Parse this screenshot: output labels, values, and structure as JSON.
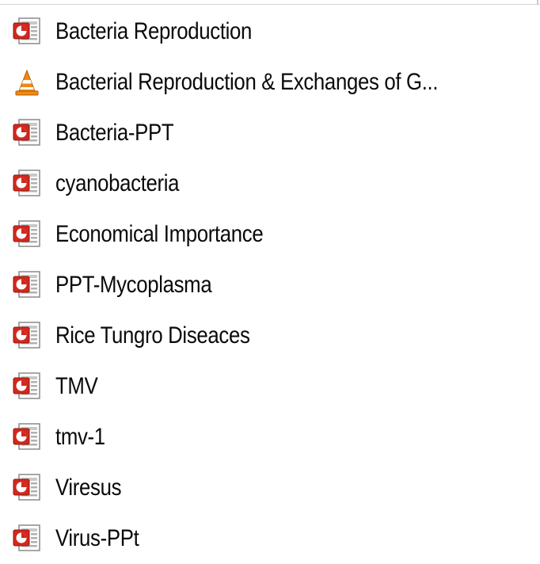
{
  "files": [
    {
      "name": "Bacteria Reproduction",
      "icon": "powerpoint-file-icon"
    },
    {
      "name": "Bacterial Reproduction & Exchanges of G...",
      "icon": "vlc-media-file-icon"
    },
    {
      "name": "Bacteria-PPT",
      "icon": "powerpoint-file-icon"
    },
    {
      "name": "cyanobacteria",
      "icon": "powerpoint-file-icon"
    },
    {
      "name": "Economical Importance",
      "icon": "powerpoint-file-icon"
    },
    {
      "name": "PPT-Mycoplasma",
      "icon": "powerpoint-file-icon"
    },
    {
      "name": "Rice Tungro Diseaces",
      "icon": "powerpoint-file-icon"
    },
    {
      "name": "TMV",
      "icon": "powerpoint-file-icon"
    },
    {
      "name": "tmv-1",
      "icon": "powerpoint-file-icon"
    },
    {
      "name": "Viresus",
      "icon": "powerpoint-file-icon"
    },
    {
      "name": "Virus-PPt",
      "icon": "powerpoint-file-icon"
    }
  ],
  "colors": {
    "ppt_red": "#d2281e",
    "vlc_orange": "#f08a14"
  }
}
